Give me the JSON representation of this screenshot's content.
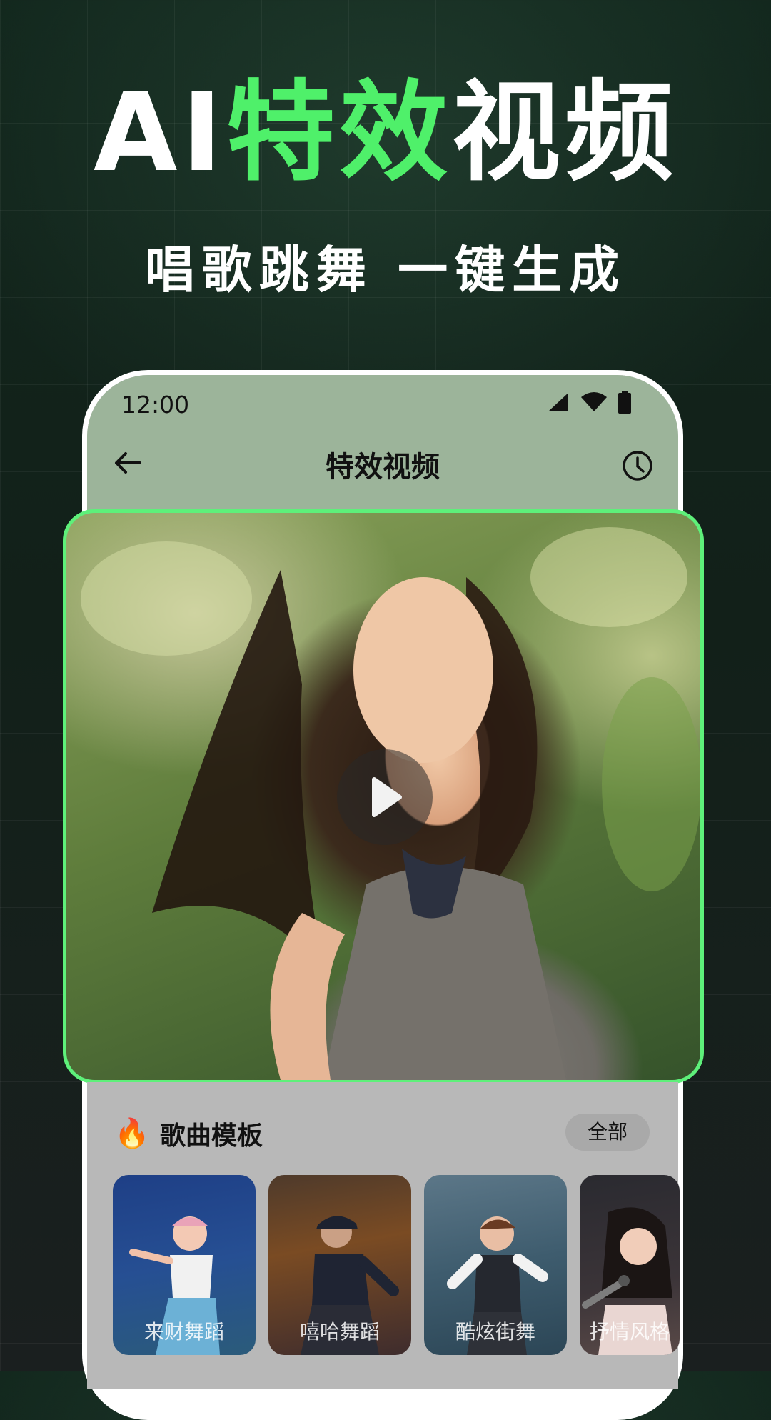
{
  "headline": {
    "prefix": "AI",
    "highlight": "特效",
    "suffix": "视频"
  },
  "subline": "唱歌跳舞 一键生成",
  "status": {
    "time": "12:00"
  },
  "appbar": {
    "title": "特效视频"
  },
  "video": {
    "state": "paused"
  },
  "section": {
    "title": "歌曲模板",
    "all_label": "全部",
    "cards": [
      {
        "label": "来财舞蹈"
      },
      {
        "label": "嘻哈舞蹈"
      },
      {
        "label": "酷炫街舞"
      },
      {
        "label": "抒情风格"
      }
    ]
  },
  "colors": {
    "accent": "#4ff06a",
    "appbar": "#9cb49a",
    "frame": "#5ef07a"
  },
  "icons": [
    "back-arrow-icon",
    "history-clock-icon",
    "play-icon",
    "fire-icon",
    "signal-icon",
    "wifi-icon",
    "battery-icon"
  ]
}
